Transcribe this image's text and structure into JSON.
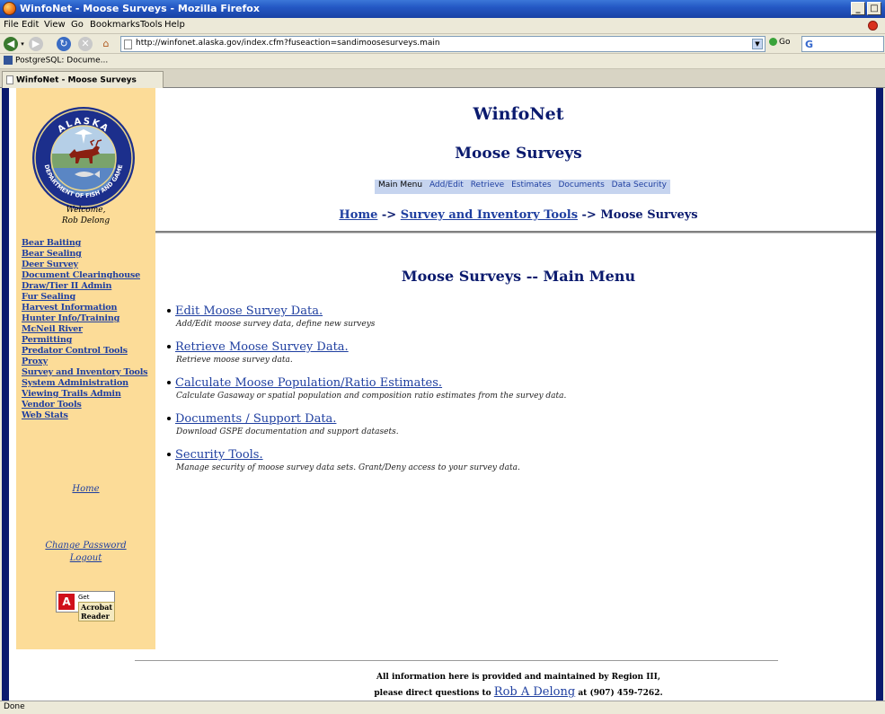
{
  "window": {
    "title": "WinfoNet - Moose Surveys - Mozilla Firefox",
    "minimize": "_",
    "maximize": "□"
  },
  "menubar": [
    "File",
    "Edit",
    "View",
    "Go",
    "Bookmarks",
    "Tools",
    "Help"
  ],
  "navbar": {
    "url": "http://winfonet.alaska.gov/index.cfm?fuseaction=sandimoosesurveys.main",
    "go_label": "Go",
    "search_engine": "G"
  },
  "bookmarks": [
    {
      "label": "PostgreSQL: Docume..."
    }
  ],
  "tabs": [
    {
      "label": "WinfoNet - Moose Surveys"
    }
  ],
  "sidebar": {
    "logo": {
      "top_text": "ALASKA",
      "bottom_text": "DEPARTMENT OF FISH AND GAME"
    },
    "welcome_line1": "Welcome,",
    "welcome_line2": "Rob Delong",
    "nav": [
      "Bear Baiting",
      "Bear Sealing",
      "Deer Survey",
      "Document Clearinghouse",
      "Draw/Tier II Admin",
      "Fur Sealing",
      "Harvest Information",
      "Hunter Info/Training",
      "McNeil River",
      "Permitting",
      "Predator Control Tools",
      "Proxy",
      "Survey and Inventory Tools",
      "System Administration",
      "Viewing Trails Admin",
      "Vendor Tools",
      "Web Stats"
    ],
    "home": "Home",
    "change_password": "Change Password",
    "logout": "Logout",
    "acrobat": {
      "get": "Get",
      "brand_line1": "Acrobat",
      "brand_line2": "Reader"
    }
  },
  "header": {
    "title": "WinfoNet",
    "subtitle": "Moose Surveys",
    "topnav": [
      "Main Menu",
      "Add/Edit",
      "Retrieve",
      "Estimates",
      "Documents",
      "Data Security"
    ],
    "breadcrumb": {
      "home": "Home",
      "sep1": " -> ",
      "section": "Survey and Inventory Tools",
      "sep2": " -> ",
      "current": "Moose Surveys"
    }
  },
  "main": {
    "heading": "Moose Surveys -- Main Menu",
    "items": [
      {
        "link": "Edit Moose Survey Data.",
        "desc": "Add/Edit moose survey data, define new surveys"
      },
      {
        "link": "Retrieve Moose Survey Data.",
        "desc": "Retrieve moose survey data."
      },
      {
        "link": "Calculate Moose Population/Ratio Estimates.",
        "desc": "Calculate Gasaway or spatial population and composition ratio estimates from the survey data."
      },
      {
        "link": "Documents / Support Data.",
        "desc": "Download GSPE documentation and support datasets."
      },
      {
        "link": "Security Tools.",
        "desc": "Manage security of moose survey data sets. Grant/Deny access to your survey data."
      }
    ]
  },
  "footer": {
    "line1": "All information here is provided and maintained by Region III,",
    "line2_pre": "please direct questions to ",
    "contact": "Rob A Delong",
    "line2_post": " at (907) 459-7262."
  },
  "status": {
    "text": "Done"
  },
  "colors": {
    "sidebar_bg": "#fcdc98",
    "frame": "#0a1a6e",
    "link": "#1f3fa0",
    "topnav_bg": "#c6d4ef"
  }
}
